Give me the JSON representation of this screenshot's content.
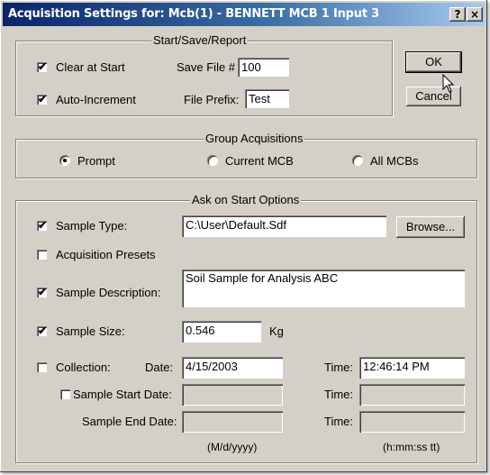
{
  "window": {
    "title": "Acquisition Settings for: Mcb(1) - BENNETT MCB 1 Input 3",
    "help_label": "?",
    "close_label": "×"
  },
  "start_save_report": {
    "legend": "Start/Save/Report",
    "clear_at_start_label": "Clear at Start",
    "clear_at_start_checked": true,
    "auto_increment_label": "Auto-Increment",
    "auto_increment_checked": true,
    "save_file_label": "Save File #",
    "save_file_value": "100",
    "file_prefix_label": "File Prefix:",
    "file_prefix_value": "Test"
  },
  "buttons": {
    "ok_label": "OK",
    "cancel_label": "Cancel",
    "browse_label": "Browse..."
  },
  "group_acquisitions": {
    "legend": "Group Acquisitions",
    "options": [
      "Prompt",
      "Current MCB",
      "All MCBs"
    ],
    "selected": "Prompt"
  },
  "ask_on_start": {
    "legend": "Ask on Start Options",
    "sample_type_label": "Sample Type:",
    "sample_type_checked": true,
    "sample_type_value": "C:\\User\\Default.Sdf",
    "acquisition_presets_label": "Acquisition Presets",
    "acquisition_presets_checked": false,
    "sample_description_label": "Sample Description:",
    "sample_description_checked": true,
    "sample_description_value": "Soil Sample for Analysis ABC",
    "sample_size_label": "Sample Size:",
    "sample_size_checked": true,
    "sample_size_value": "0.546",
    "sample_size_unit": "Kg",
    "collection_label": "Collection:",
    "collection_checked": false,
    "date_label": "Date:",
    "collection_date_value": "4/15/2003",
    "time_label": "Time:",
    "collection_time_value": "12:46:14 PM",
    "sample_start_date_label": "Sample Start Date:",
    "sample_start_date_checked": false,
    "sample_end_date_label": "Sample End Date:",
    "date_format_hint": "(M/d/yyyy)",
    "time_format_hint": "(h:mm:ss tt)"
  },
  "check_glyph": "✔"
}
